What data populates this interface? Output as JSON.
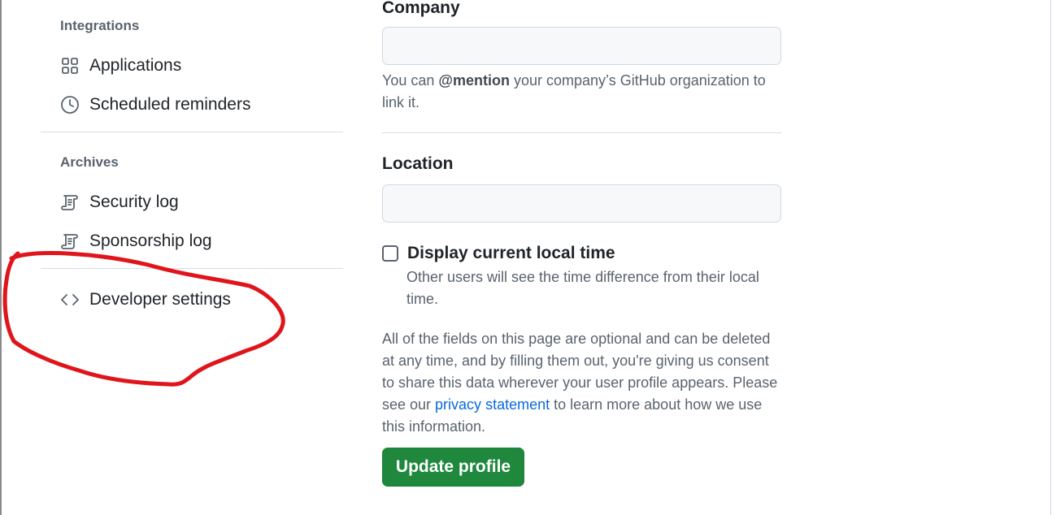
{
  "sidebar": {
    "integrations_heading": "Integrations",
    "archives_heading": "Archives",
    "items": [
      {
        "label": "Applications",
        "icon": "apps-icon"
      },
      {
        "label": "Scheduled reminders",
        "icon": "clock-icon"
      },
      {
        "label": "Security log",
        "icon": "log-icon"
      },
      {
        "label": "Sponsorship log",
        "icon": "log-icon"
      },
      {
        "label": "Developer settings",
        "icon": "code-icon"
      }
    ]
  },
  "form": {
    "company": {
      "label": "Company",
      "value": "",
      "note_prefix": "You can ",
      "note_mention": "@mention",
      "note_suffix": " your company’s GitHub organization to link it."
    },
    "location": {
      "label": "Location",
      "value": ""
    },
    "local_time": {
      "label": "Display current local time",
      "checked": false,
      "note": "Other users will see the time difference from their local time."
    },
    "consent": {
      "text_before": "All of the fields on this page are optional and can be deleted at any time, and by filling them out, you're giving us consent to share this data wherever your user profile appears. Please see our ",
      "link_text": "privacy statement",
      "text_after": " to learn more about how we use this information."
    },
    "submit_label": "Update profile"
  },
  "colors": {
    "primary_button": "#1f883d",
    "link": "#0969da",
    "annotation": "#e0141b"
  }
}
